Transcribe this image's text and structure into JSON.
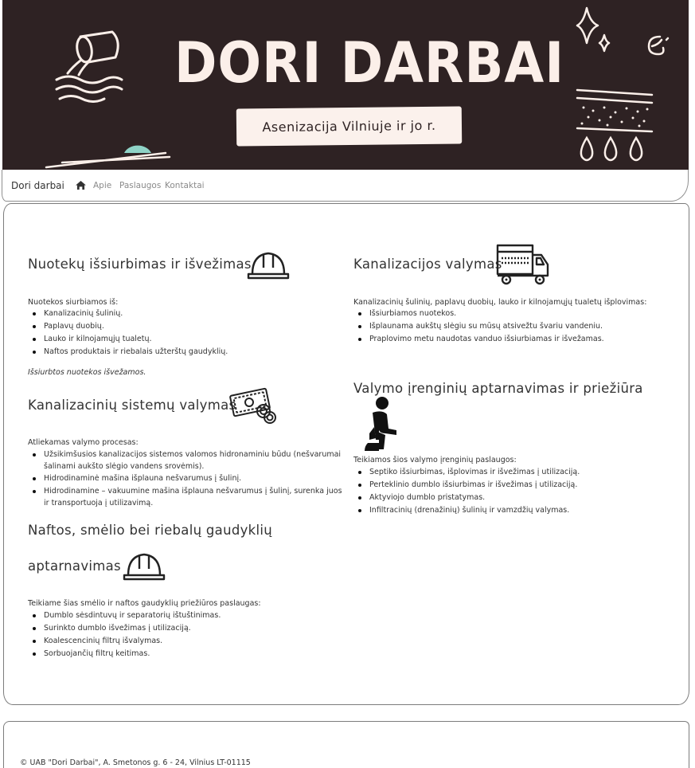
{
  "banner": {
    "title": "DORI DARBAI",
    "subtitle": "Asenizacija Vilniuje ir jo r."
  },
  "nav": {
    "brand": "Dori darbai",
    "links": [
      "Apie",
      "Paslaugos",
      "Kontaktai"
    ]
  },
  "sections": {
    "nuotekos": {
      "title": "Nuotekų išsiurbimas ir išvežimas",
      "intro": "Nuotekos siurbiamos iš:",
      "items": [
        "Kanalizacinių šulinių.",
        "Paplavų duobių.",
        "Lauko ir kilnojamųjų tualetų.",
        "Naftos produktais ir riebalais užterštų gaudyklių."
      ],
      "note": "Išsiurbtos nuotekos išvežamos."
    },
    "kanalizacijos": {
      "title": "Kanalizacijos valymas",
      "intro": "Kanalizacinių šulinių, paplavų duobių, lauko ir kilnojamųjų tualetų išplovimas:",
      "items": [
        "Išsiurbiamos nuotekos.",
        "Išplaunama aukštų slėgiu su mūsų atsivežtu švariu vandeniu.",
        "Praplovimo metu naudotas vanduo išsiurbiamas ir išvežamas."
      ]
    },
    "sistemu": {
      "title": "Kanalizacinių sistemų valymas",
      "intro": "Atliekamas valymo procesas:",
      "items": [
        "Užsikimšusios kanalizacijos sistemos valomos hidronaminiu būdu (nešvarumai šalinami aukšto slėgio vandens srovėmis).",
        "Hidrodinaminė mašina išplauna nešvarumus į šulinį.",
        "Hidrodinamine – vakuumine mašina išplauna nešvarumus į šulinį, surenka juos ir transportuoja į utilizavimą."
      ]
    },
    "irenginiu": {
      "title": "Valymo įrenginių aptarnavimas ir priežiūra",
      "intro": "Teikiamos šios valymo įrenginių paslaugos:",
      "items": [
        "Septiko išsiurbimas, išplovimas ir išvežimas į utilizaciją.",
        "Perteklinio dumblo išsiurbimas ir išvežimas į utilizaciją.",
        "Aktyviojo dumblo pristatymas.",
        "Infiltracinių (drenažinių) šulinių ir vamzdžių valymas."
      ]
    },
    "gaudykliu": {
      "title_line1": "Naftos, smėlio bei riebalų gaudyklių",
      "title_line2": "aptarnavimas",
      "intro": "Teikiame šias smėlio ir naftos gaudyklių priežiūros paslaugas:",
      "items": [
        "Dumblo sėsdintuvų ir separatorių ištuštinimas.",
        "Surinkto dumblo išvežimas į utilizaciją.",
        "Koalescencinių filtrų išvalymas.",
        "Sorbuojančių filtrų keitimas."
      ]
    }
  },
  "footer": {
    "text": "© UAB \"Dori Darbai\", A. Smetonos g. 6 - 24, Vilnius LT-01115"
  },
  "colors": {
    "banner_bg": "#2e2223",
    "banner_text": "#fbefe9",
    "accent_mint": "#8fd3c7"
  }
}
